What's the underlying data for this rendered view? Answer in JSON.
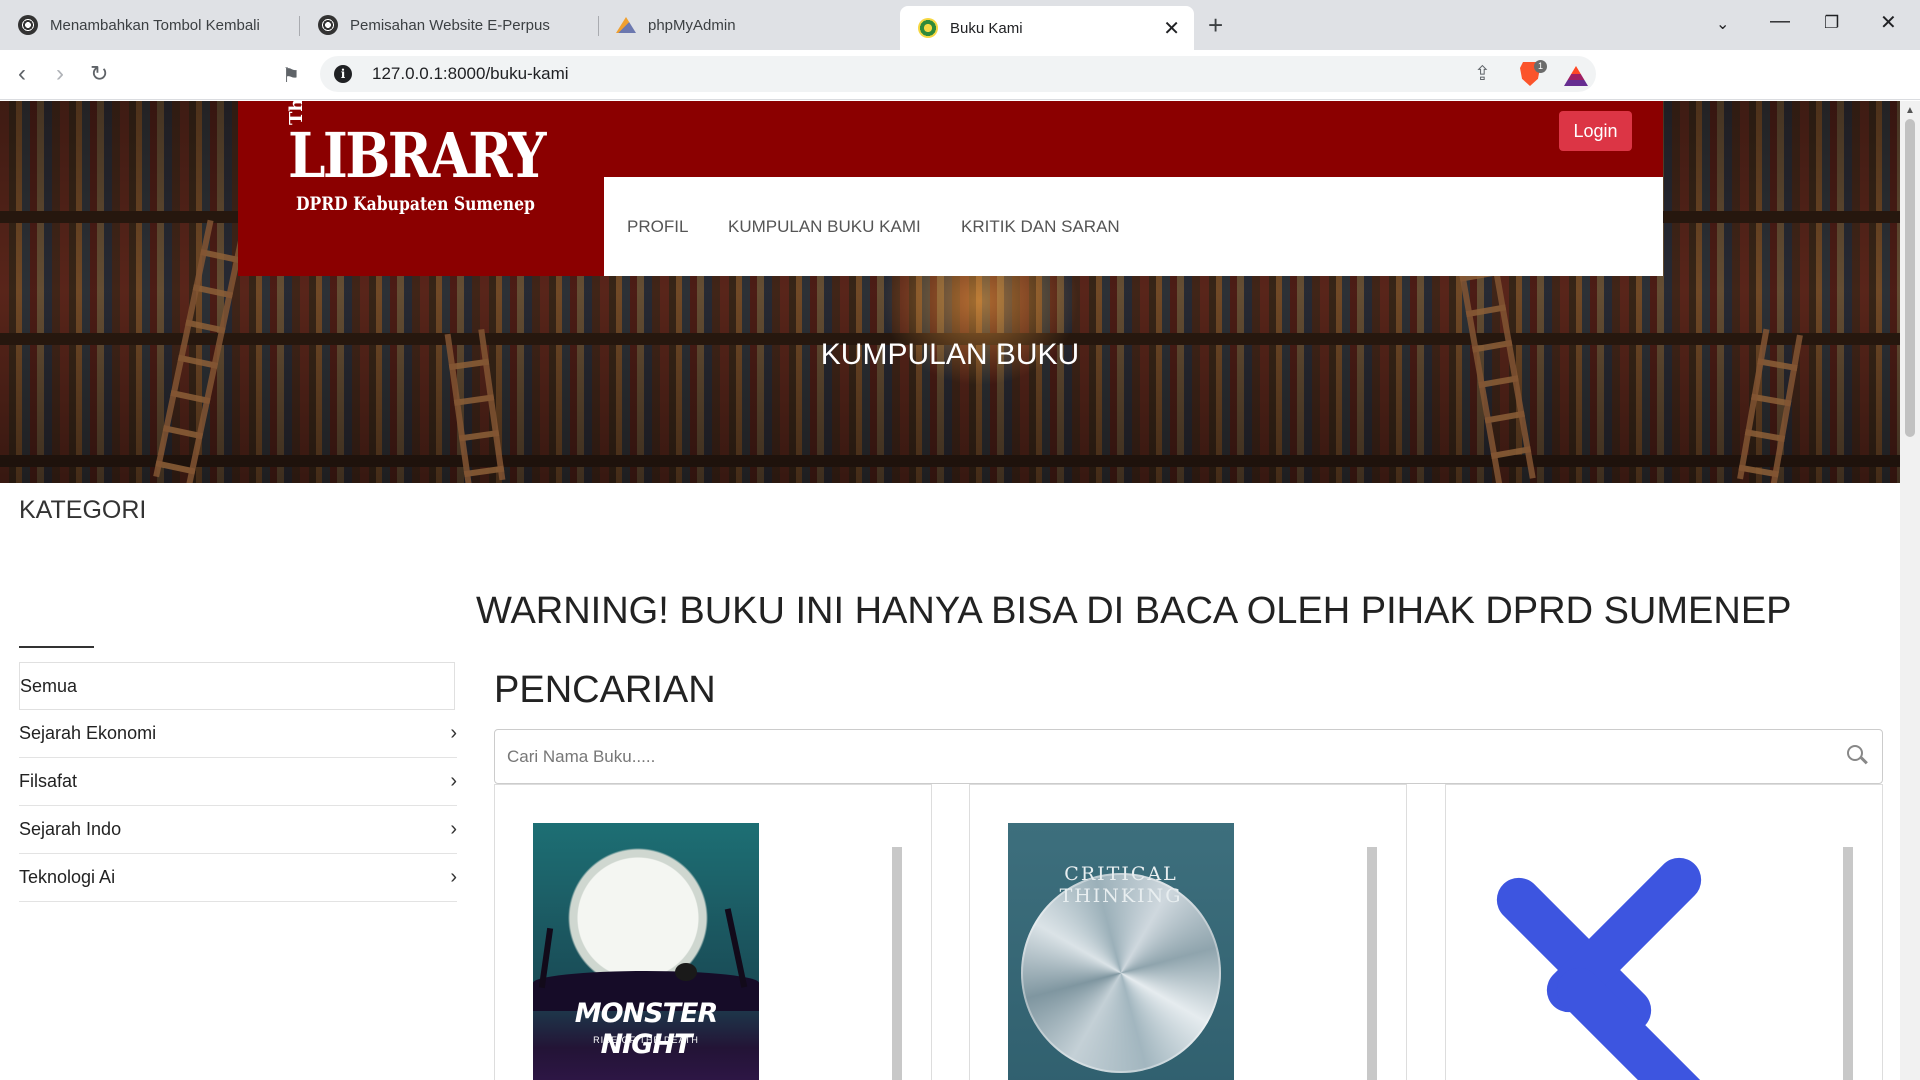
{
  "browser": {
    "tabs": [
      {
        "title": "Menambahkan Tombol Kembali",
        "favicon": "openai-icon"
      },
      {
        "title": "Pemisahan Website E-Perpus",
        "favicon": "openai-icon"
      },
      {
        "title": "phpMyAdmin",
        "favicon": "phpmyadmin-icon"
      },
      {
        "title": "Buku Kami",
        "favicon": "government-seal-icon",
        "active": true
      }
    ],
    "url": "127.0.0.1:8000/buku-kami",
    "brave_badge": "1"
  },
  "header": {
    "logo": {
      "the": "The",
      "library": "LIBRARY",
      "subtitle": "DPRD Kabupaten Sumenep"
    },
    "login_label": "Login",
    "menu": [
      "PROFIL",
      "KUMPULAN BUKU KAMI",
      "KRITIK DAN SARAN"
    ],
    "hero_title": "KUMPULAN BUKU"
  },
  "sidebar": {
    "title": "KATEGORI",
    "items": [
      {
        "label": "Semua",
        "selected": true
      },
      {
        "label": "Sejarah Ekonomi"
      },
      {
        "label": "Filsafat"
      },
      {
        "label": "Sejarah Indo"
      },
      {
        "label": "Teknologi Ai"
      }
    ]
  },
  "main": {
    "warning": "WARNING! BUKU INI HANYA BISA DI BACA OLEH PIHAK DPRD SUMENEP",
    "search_title": "PENCARIAN",
    "search_placeholder": "Cari Nama Buku.....",
    "books": [
      {
        "cover_title": "MONSTER NIGHT",
        "cover_subtitle": "RISE OF THE DEATH"
      },
      {
        "cover_title": "CRITICAL THINKING"
      },
      {
        "cover_title": ""
      }
    ]
  },
  "colors": {
    "brand": "#8b0000",
    "login": "#dc3545",
    "accent_blue": "#3d55e0"
  }
}
